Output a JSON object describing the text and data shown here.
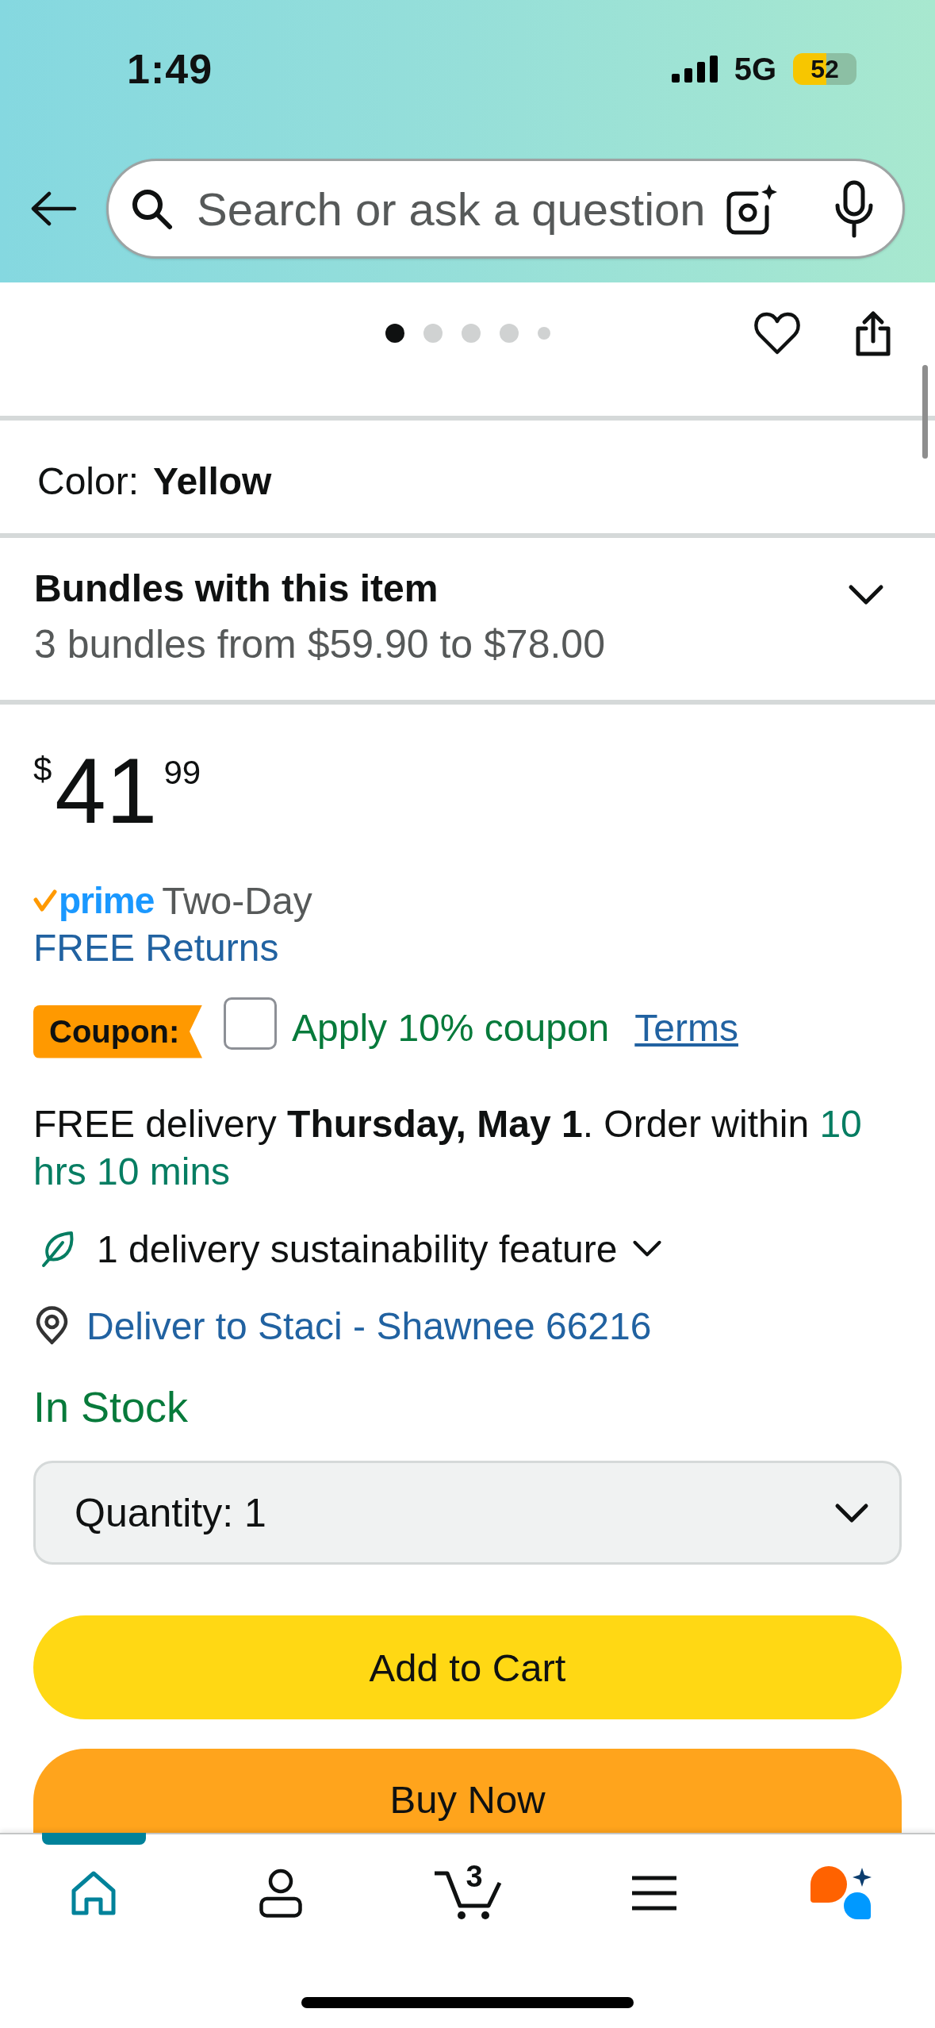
{
  "status_bar": {
    "time": "1:49",
    "network": "5G",
    "battery": "52"
  },
  "search": {
    "placeholder": "Search or ask a question"
  },
  "image_carousel": {
    "dots": [
      {
        "selected": true
      },
      {
        "selected": false
      },
      {
        "selected": false
      },
      {
        "selected": false
      },
      {
        "selected": false
      }
    ]
  },
  "variant": {
    "label": "Color:",
    "value": "Yellow"
  },
  "bundles": {
    "title": "Bundles with this item",
    "subtitle": "3 bundles from $59.90 to $78.00",
    "expanded": false
  },
  "price": {
    "currency": "$",
    "whole": "41",
    "fraction": "99"
  },
  "prime": {
    "badge": "prime",
    "speed": "Two-Day"
  },
  "returns_link": "FREE Returns",
  "coupon": {
    "badge": "Coupon:",
    "checked": false,
    "label": "Apply 10% coupon",
    "terms": "Terms"
  },
  "delivery": {
    "text": "FREE delivery **Thursday, May 1**. Order within",
    "countdown": "10 hrs 10 mins"
  },
  "sustainability": {
    "label": "1 delivery sustainability feature",
    "expanded": false
  },
  "deliver_to": "Deliver to Staci - Shawnee 66216",
  "availability": "In Stock",
  "quantity": {
    "label": "Quantity:",
    "value": "1"
  },
  "buttons": [
    {
      "kind": "add_to_cart",
      "label": "Add to Cart"
    },
    {
      "kind": "buy_now",
      "label": "Buy Now"
    }
  ],
  "tab_bar": [
    {
      "kind": "home",
      "selected": true
    },
    {
      "kind": "account",
      "selected": false
    },
    {
      "kind": "cart",
      "selected": false,
      "count": "3"
    },
    {
      "kind": "menu",
      "selected": false
    },
    {
      "kind": "assistant",
      "selected": false
    }
  ]
}
